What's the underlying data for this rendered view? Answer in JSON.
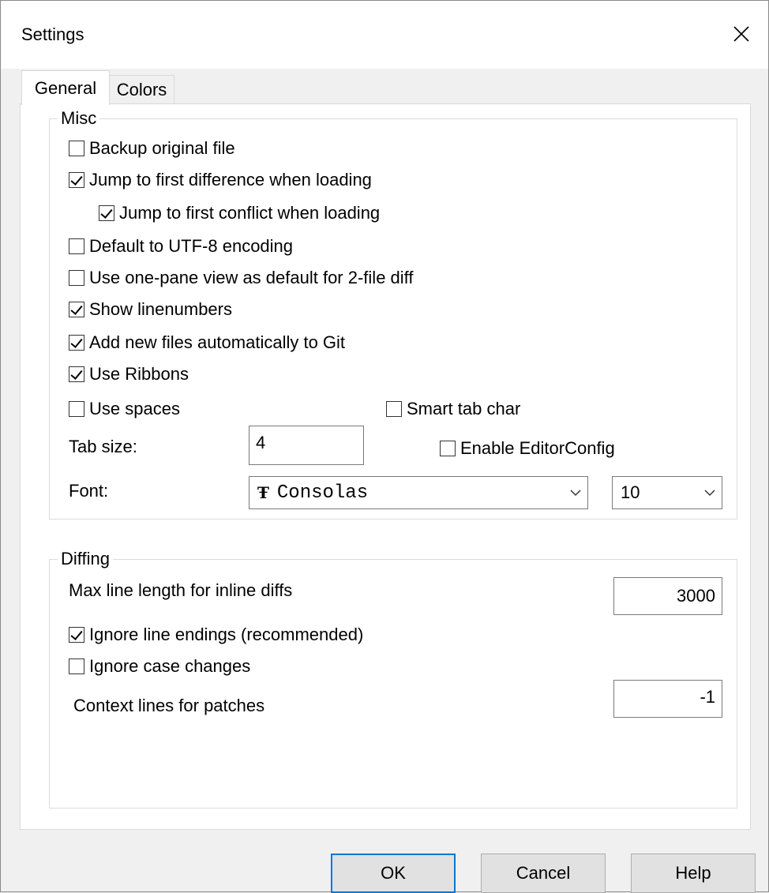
{
  "window": {
    "title": "Settings"
  },
  "tabs": [
    {
      "label": "General",
      "active": true
    },
    {
      "label": "Colors",
      "active": false
    }
  ],
  "misc": {
    "legend": "Misc",
    "backup": {
      "label": "Backup original file",
      "checked": false
    },
    "jump_first_diff": {
      "label": "Jump to first difference when loading",
      "checked": true
    },
    "jump_first_conflict": {
      "label": "Jump to first conflict when loading",
      "checked": true
    },
    "utf8": {
      "label": "Default to UTF-8 encoding",
      "checked": false
    },
    "one_pane": {
      "label": "Use one-pane view as default for 2-file diff",
      "checked": false
    },
    "linenumbers": {
      "label": "Show linenumbers",
      "checked": true
    },
    "add_git": {
      "label": "Add new files automatically to Git",
      "checked": true
    },
    "ribbons": {
      "label": "Use Ribbons",
      "checked": true
    },
    "use_spaces": {
      "label": "Use spaces",
      "checked": false
    },
    "smart_tab": {
      "label": "Smart tab char",
      "checked": false
    },
    "tab_size_label": "Tab size:",
    "tab_size_value": "4",
    "editorconfig": {
      "label": "Enable EditorConfig",
      "checked": false
    },
    "font_label": "Font:",
    "font_glyph": "Ŧ",
    "font_value": "Consolas",
    "font_size_value": "10"
  },
  "diffing": {
    "legend": "Diffing",
    "max_line_label": "Max line length for inline diffs",
    "max_line_value": "3000",
    "ignore_eol": {
      "label": "Ignore line endings (recommended)",
      "checked": true
    },
    "ignore_case": {
      "label": "Ignore case changes",
      "checked": false
    },
    "context_label": "Context lines for patches",
    "context_value": "-1"
  },
  "buttons": {
    "ok": "OK",
    "cancel": "Cancel",
    "help": "Help"
  }
}
